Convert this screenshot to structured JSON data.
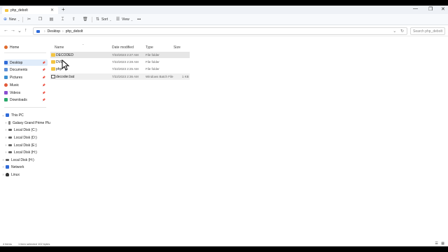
{
  "tab": {
    "title": "php_debolt",
    "close": "✕",
    "new": "+"
  },
  "window_controls": {
    "minimize": "—",
    "maximize": "❐",
    "close": "✕"
  },
  "toolbar": {
    "new_label": "New",
    "sort_label": "Sort",
    "view_label": "View",
    "more": "•••"
  },
  "address": {
    "crumbs": [
      "Desktop",
      "php_debolt"
    ],
    "search_placeholder": "Search php_debolt"
  },
  "sidebar": {
    "quick": [
      {
        "label": "Home"
      },
      {
        "label": "Desktop"
      },
      {
        "label": "Documents"
      },
      {
        "label": "Pictures"
      },
      {
        "label": "Music"
      },
      {
        "label": "Videos"
      },
      {
        "label": "Downloads"
      }
    ],
    "tree": [
      {
        "label": "This PC"
      },
      {
        "label": "Galaxy Grand Prime Plus"
      },
      {
        "label": "Local Disk (C:)"
      },
      {
        "label": "Local Disk (D:)"
      },
      {
        "label": "Local Disk (E:)"
      },
      {
        "label": "Local Disk (H:)"
      },
      {
        "label": "Local Disk (H:)"
      },
      {
        "label": "Network"
      },
      {
        "label": "Linux"
      }
    ]
  },
  "columns": {
    "name": "Name",
    "date": "Date modified",
    "type": "Type",
    "size": "Size"
  },
  "files": [
    {
      "name": "DECODED",
      "date": "7/22/2023 2:27 AM",
      "type": "File folder",
      "size": ""
    },
    {
      "name": "DVD",
      "date": "7/22/2023 2:28 AM",
      "type": "File folder",
      "size": ""
    },
    {
      "name": "php",
      "date": "7/22/2023 2:25 AM",
      "type": "File folder",
      "size": ""
    },
    {
      "name": "decoder.bat",
      "date": "7/22/2023 2:36 AM",
      "type": "Windows Batch File",
      "size": "1 KB"
    }
  ],
  "status": {
    "items": "4 items",
    "selected": "1 item selected  102 bytes"
  },
  "colors": {
    "folder": "#f4c542",
    "selected_nav": "#e0ecfa",
    "accent": "#2f6bd8"
  }
}
